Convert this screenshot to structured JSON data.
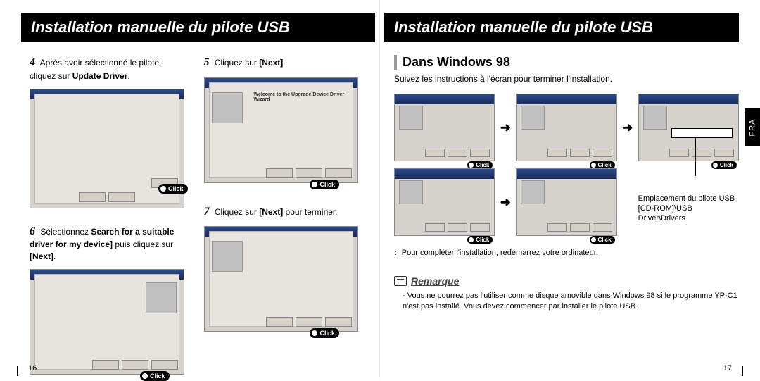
{
  "titles": {
    "left": "Installation manuelle du pilote USB",
    "right": "Installation manuelle du pilote USB"
  },
  "left_page": {
    "step4_num": "4",
    "step4_text_1": "Après avoir sélectionné le pilote, cliquez sur ",
    "step4_bold": "Update Driver",
    "step4_text_2": ".",
    "step6_num": "6",
    "step6_text_1": "Sélectionnez  ",
    "step6_bold": "Search for a suitable driver for my device]",
    "step6_text_2": " puis cliquez sur  ",
    "step6_bold2": "[Next]",
    "step5_num": "5",
    "step5_text_1": "Cliquez sur ",
    "step5_bold": "[Next]",
    "step5_text_2": ".",
    "step7_num": "7",
    "step7_text_1": "Cliquez sur ",
    "step7_bold": "[Next]",
    "step7_text_2": " pour terminer.",
    "click_label": "Click",
    "page_num": "16",
    "shot5_heading": "Welcome to the Upgrade Device Driver Wizard"
  },
  "right_page": {
    "section": "Dans Windows 98",
    "lead": "Suivez les instructions à l'écran pour terminer l'installation.",
    "click_label": "Click",
    "driver_loc_label": "Emplacement du pilote USB",
    "driver_loc_path": "[CD-ROM]\\USB Driver\\Drivers",
    "note": "Pour compléter l'installation, redémarrez votre ordinateur.",
    "remark_title": "Remarque",
    "remark_body": "- Vous ne pourrez pas l'utiliser comme disque amovible dans Windows 98 si le programme YP-C1 n'est pas installé. Vous devez commencer par installer le pilote USB.",
    "page_num": "17",
    "side_tab": "FRA"
  }
}
